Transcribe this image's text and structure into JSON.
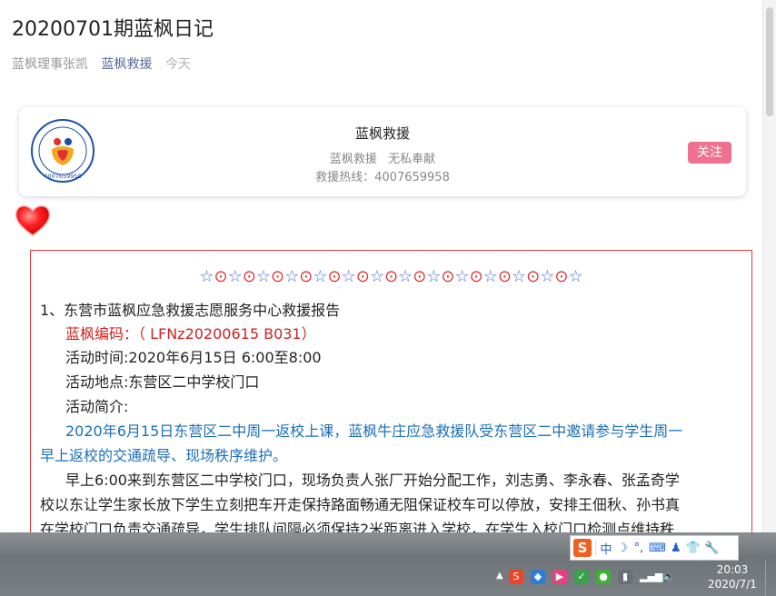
{
  "article": {
    "title": "20200701期蓝枫日记",
    "author": "蓝枫理事张凯",
    "account": "蓝枫救援",
    "date": "今天"
  },
  "profile_card": {
    "name": "蓝枫救援",
    "tagline_1": "蓝枫救援",
    "tagline_2": "无私奉献",
    "hotline": "救援热线：4007659958",
    "logo_text": "4007659958",
    "follow_label": "关注",
    "follow_color": "#f0708f"
  },
  "report": {
    "decoration": "☆⊙☆⊙☆⊙☆⊙☆⊙☆⊙☆⊙☆⊙☆⊙☆⊙☆⊙☆⊙☆⊙☆",
    "title": "1、东营市蓝枫应急救援志愿服务中心救援报告",
    "code": "蓝枫编码：（ LFNz20200615  B031）",
    "time": "活动时间:2020年6月15日     6:00至8:00",
    "place": "活动地点:东营区二中学校门口",
    "intro_label": "活动简介:",
    "para1_line1": "2020年6月15日东营区二中周一返校上课，蓝枫牛庄应急救援队受东营区二中邀请参与学生周一",
    "para1_line2": "早上返校的交通疏导、现场秩序维护。",
    "para2_line1": "早上6:00来到东营区二中学校门口，现场负责人张厂开始分配工作，刘志勇、李永春、张孟奇学",
    "para2_line2": "校以东让学生家长放下学生立刻把车开走保持路面畅通无阻保证校车可以停放，安排王佃秋、孙书真",
    "para2_line3": "在学校门口负责交通疏导，学生排队间隔必须保持2米距离进入学校，在学生入校门口检测点维持秩",
    "border_color": "#e03a3a",
    "code_color": "#d42020",
    "blue_text_color": "#1a6fb8"
  },
  "ime_toolbar": {
    "logo": "S",
    "items": [
      "中",
      "☽",
      "°,",
      "⌨",
      "♟",
      "👕",
      "🔧"
    ]
  },
  "taskbar": {
    "time": "20:03",
    "date": "2020/7/1"
  }
}
